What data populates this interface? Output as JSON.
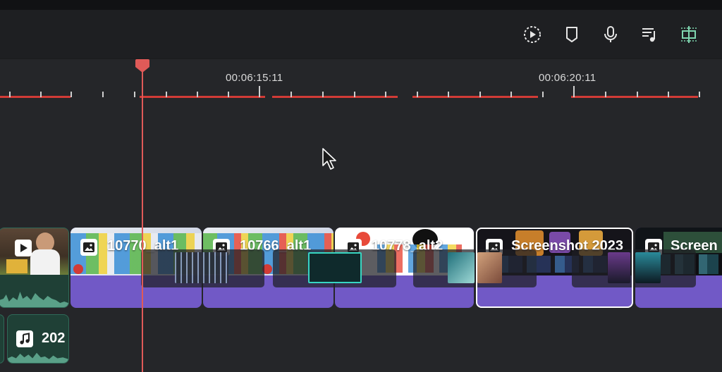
{
  "toolbar": {
    "buttons": [
      {
        "name": "playback-speed-icon"
      },
      {
        "name": "marker-icon"
      },
      {
        "name": "microphone-icon"
      },
      {
        "name": "music-playlist-icon"
      },
      {
        "name": "split-align-icon"
      }
    ]
  },
  "ruler": {
    "timecodes": [
      "00:06:15:11",
      "00:06:20:11"
    ]
  },
  "clips": {
    "video": [
      {
        "label": "",
        "icon": "play-icon"
      },
      {
        "label": "10770_alt1",
        "icon": "image-icon"
      },
      {
        "label": "10766_alt1",
        "icon": "image-icon"
      },
      {
        "label": "10778_alt2",
        "icon": "image-icon"
      },
      {
        "label": "Screenshot 2023",
        "icon": "image-icon"
      },
      {
        "label": "Screen",
        "icon": "image-icon"
      }
    ],
    "audio": [
      {
        "label": "202",
        "icon": "music-note-icon"
      }
    ]
  },
  "colors": {
    "accent_red": "#d23b36",
    "clip_purple": "#7159c6",
    "audio_green": "#1f4036",
    "playhead": "#e05a58"
  }
}
